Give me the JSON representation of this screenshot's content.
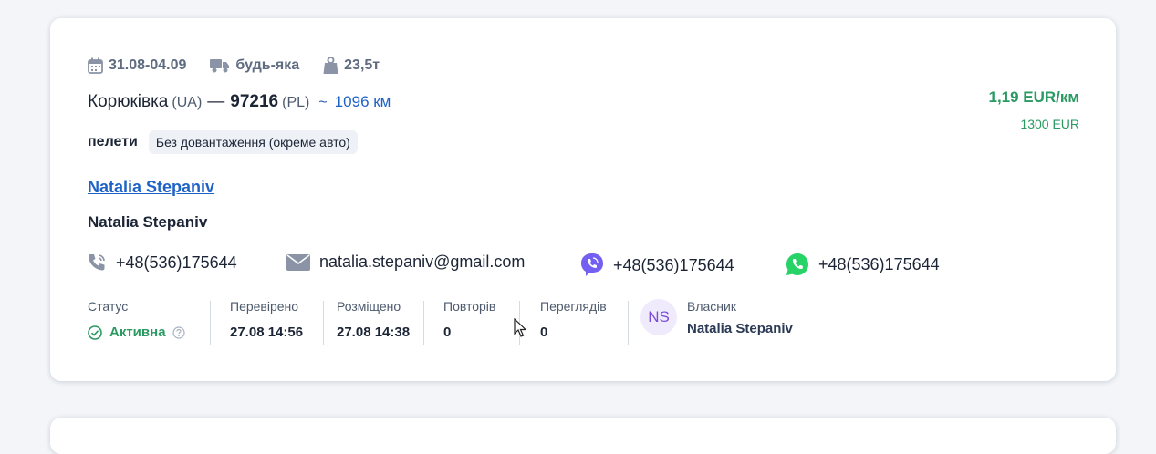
{
  "meta": {
    "dates": "31.08-04.09",
    "truck_type": "будь-яка",
    "weight": "23,5т"
  },
  "route": {
    "from_city": "Корюківка",
    "from_country": "(UA)",
    "separator": "—",
    "to_city": "97216",
    "to_country": "(PL)",
    "tilde": "~",
    "distance": "1096 км"
  },
  "price": {
    "per_km": "1,19 EUR/км",
    "total": "1300 EUR"
  },
  "cargo": {
    "name": "пелети",
    "tag": "Без довантаження (окреме авто)"
  },
  "company_link": "Natalia Stepaniv",
  "contact_name": "Natalia Stepaniv",
  "contacts": {
    "phone": "+48(536)175644",
    "email": "natalia.stepaniv@gmail.com",
    "viber": "+48(536)175644",
    "whatsapp": "+48(536)175644"
  },
  "stats": {
    "status_label": "Статус",
    "status_value": "Активна",
    "checked_label": "Перевірено",
    "checked_value": "27.08 14:56",
    "posted_label": "Розміщено",
    "posted_value": "27.08 14:38",
    "repeats_label": "Повторів",
    "repeats_value": "0",
    "views_label": "Переглядів",
    "views_value": "0",
    "owner_label": "Власник",
    "owner_initials": "NS",
    "owner_name": "Natalia Stepaniv"
  },
  "colors": {
    "accent_link": "#1e62c7",
    "price_green": "#2a9a62",
    "viber": "#7360f2",
    "whatsapp": "#25d366"
  }
}
